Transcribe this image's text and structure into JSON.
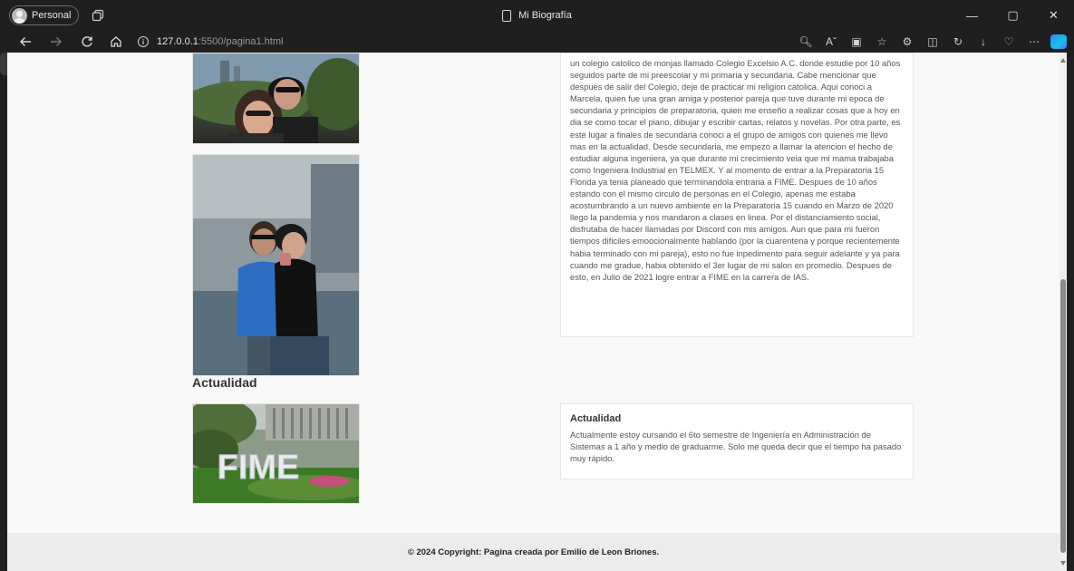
{
  "window": {
    "profile_label": "Personal",
    "title": "Mi Biografía",
    "controls": {
      "minimize": "—",
      "maximize": "▢",
      "close": "✕"
    }
  },
  "toolbar": {
    "url_host": "127.0.0.1",
    "url_rest": ":5500/pagina1.html",
    "icons": [
      "back-icon",
      "forward-icon",
      "refresh-icon",
      "home-icon",
      "zoom-icon",
      "read-aloud-icon",
      "immersive-reader-icon",
      "favorite-icon",
      "extensions-icon",
      "split-screen-icon",
      "history-icon",
      "downloads-icon",
      "browser-essentials-icon",
      "more-icon",
      "copilot-icon"
    ]
  },
  "sidebar": {
    "items": [
      "tab-actions-icon",
      "tab-icon",
      "tab-icon",
      "youtube-icon",
      "tab-icon",
      "github-icon",
      "page-icon",
      "add-icon"
    ]
  },
  "page": {
    "story_text": "un colegio catolico de monjas llamado Colegio Excelsio A.C. donde estudie por 10 años seguidos parte de mi preescolar y mi primaria y secundaria. Cabe mencionar que despues de salir del Colegio, deje de practicar mi religion catolica. Aqui conoci a Marcela, quien fue una gran amiga y posterior pareja que tuve durante mi epoca de secundaria y principios de preparatoria, quien me enseño a realizar cosas que a hoy en dia se como tocar el piano, dibujar y escribir cartas, relatos y novelas. Por otra parte, es este lugar a finales de secundaria conoci a el grupo de amigos con quienes me llevo mas en la actualidad. Desde secundaria, me empezo a llamar la atencion el hecho de estudiar alguna ingeniera, ya que durante mi crecimiento veia que mi mama trabajaba como Ingeniera Industrial en TELMEX. Y al momento de entrar a la Preparatoria 15 Florida ya tenia planeado que terminandola entraria a FIME. Despues de 10 años estando con el mismo circulo de personas en el Colegio, apenas me estaba acostumbrando a un nuevo ambiente en la Preparatoria 15 cuando en Marzo de 2020 llego la pandemia y nos mandaron a clases en linea. Por el distanciamiento social, disfrutaba de hacer llamadas por Discord con mis amigos. Aun que para mi fueron tiempos dificiles emoocionalmente hablando (por la cuarentena y porque recientemente habia terminado con mi pareja), esto no fue inpedimento para seguir adelante y ya para cuando me gradue, habia obtenido el 3er lugar de mi salon en promedio. Despues de esto, en Julio de 2021 logre entrar a FIME en la carrera de IAS.",
    "section_heading": "Actualidad",
    "card_title": "Actualidad",
    "card_text": "Actualmente estoy cursando el 6to semestre de Ingeniería en Administración de Sistemas a 1 año y medio de graduarme. Solo me queda decir que el tiempo ha pasado muy rápido.",
    "fime_sign": "FIME",
    "footer": "© 2024 Copyright: Pagina creada por Emilio de Leon Briones."
  }
}
